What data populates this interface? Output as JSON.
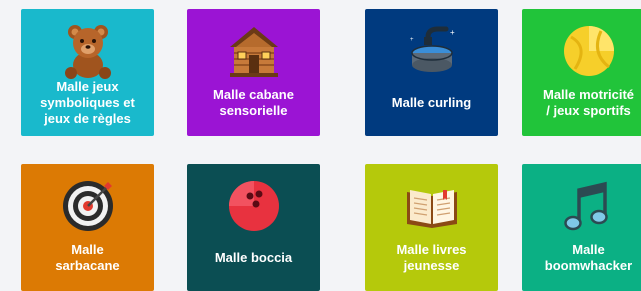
{
  "tiles": [
    {
      "label": "Malle jeux\nsymboliques et\njeux de règles",
      "icon": "teddy-bear-icon",
      "color": "#19b9cc"
    },
    {
      "label": "Malle cabane\nsensorielle",
      "icon": "log-cabin-icon",
      "color": "#9b14d4"
    },
    {
      "label": "Malle curling",
      "icon": "curling-stone-icon",
      "color": "#003a7f"
    },
    {
      "label": "Malle motricité\n/ jeux sportifs",
      "icon": "ball-icon",
      "color": "#21c43a"
    },
    {
      "label": "Malle\nsarbacane",
      "icon": "target-icon",
      "color": "#dc7a04"
    },
    {
      "label": "Malle boccia",
      "icon": "bowling-ball-icon",
      "color": "#0b4e53"
    },
    {
      "label": "Malle livres\njeunesse",
      "icon": "open-book-icon",
      "color": "#b5c90b"
    },
    {
      "label": "Malle\nboomwhacker",
      "icon": "music-note-icon",
      "color": "#0bb084"
    }
  ]
}
